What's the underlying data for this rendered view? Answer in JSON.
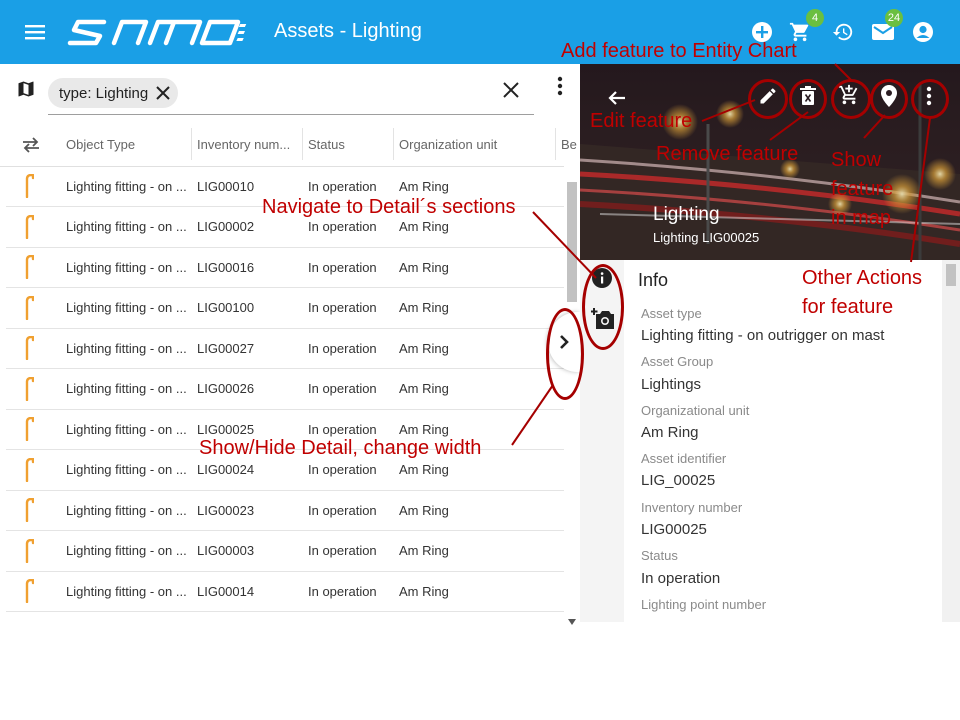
{
  "app": {
    "logo": "samo",
    "title": "Assets - Lighting",
    "notifications": {
      "cart_count": "4",
      "mail_count": "24"
    }
  },
  "filter": {
    "chip_label": "type: Lighting"
  },
  "grid": {
    "columns": [
      "Object Type",
      "Inventory num...",
      "Status",
      "Organization unit",
      "Be"
    ],
    "rows": [
      {
        "type": "Lighting fitting - on ...",
        "inventory": "LIG00010",
        "status": "In operation",
        "org": "Am Ring"
      },
      {
        "type": "Lighting fitting - on ...",
        "inventory": "LIG00002",
        "status": "In operation",
        "org": "Am Ring"
      },
      {
        "type": "Lighting fitting - on ...",
        "inventory": "LIG00016",
        "status": "In operation",
        "org": "Am Ring"
      },
      {
        "type": "Lighting fitting - on ...",
        "inventory": "LIG00100",
        "status": "In operation",
        "org": "Am Ring"
      },
      {
        "type": "Lighting fitting - on ...",
        "inventory": "LIG00027",
        "status": "In operation",
        "org": "Am Ring"
      },
      {
        "type": "Lighting fitting - on ...",
        "inventory": "LIG00026",
        "status": "In operation",
        "org": "Am Ring"
      },
      {
        "type": "Lighting fitting - on ...",
        "inventory": "LIG00025",
        "status": "In operation",
        "org": "Am Ring"
      },
      {
        "type": "Lighting fitting - on ...",
        "inventory": "LIG00024",
        "status": "In operation",
        "org": "Am Ring"
      },
      {
        "type": "Lighting fitting - on ...",
        "inventory": "LIG00023",
        "status": "In operation",
        "org": "Am Ring"
      },
      {
        "type": "Lighting fitting - on ...",
        "inventory": "LIG00003",
        "status": "In operation",
        "org": "Am Ring"
      },
      {
        "type": "Lighting fitting - on ...",
        "inventory": "LIG00014",
        "status": "In operation",
        "org": "Am Ring"
      }
    ]
  },
  "detail": {
    "hero_title": "Lighting",
    "hero_subtitle": "Lighting LIG00025",
    "section_title": "Info",
    "fields": [
      {
        "label": "Asset type",
        "value": "Lighting fitting - on outrigger on mast"
      },
      {
        "label": "Asset Group",
        "value": "Lightings"
      },
      {
        "label": "Organizational unit",
        "value": "Am Ring"
      },
      {
        "label": "Asset identifier",
        "value": "LIG_00025"
      },
      {
        "label": "Inventory number",
        "value": "LIG00025"
      },
      {
        "label": "Status",
        "value": "In operation"
      },
      {
        "label": "Lighting point number",
        "value": ""
      }
    ]
  },
  "annotations": {
    "add_feature": "Add feature to Entity Chart",
    "edit_feature": "Edit feature",
    "remove_feature": "Remove feature",
    "show_feature_1": "Show",
    "show_feature_2": "feature",
    "show_feature_3": "in map",
    "navigate_sections": "Navigate to Detail´s sections",
    "other_actions_1": "Other Actions",
    "other_actions_2": "for feature",
    "show_hide_detail": "Show/Hide Detail, change width"
  },
  "colors": {
    "topbar": "#1a9fe6",
    "annotation": "#c00000",
    "ring": "#a50000",
    "lamp_icon": "#f0a030",
    "badge": "#6abf40"
  }
}
